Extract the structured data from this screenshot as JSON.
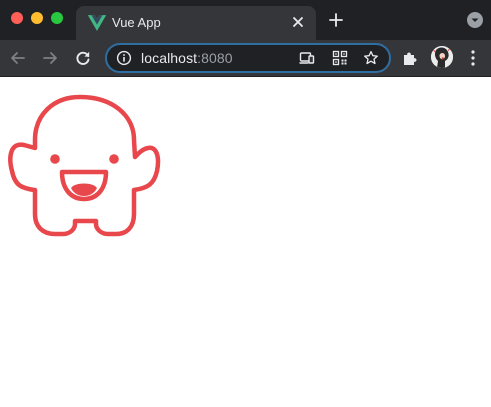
{
  "browser": {
    "tab": {
      "title": "Vue App",
      "favicon": "vue-logo-icon"
    },
    "address_bar": {
      "host": "localhost",
      "port": ":8080"
    },
    "colors": {
      "tabstrip": "#202124",
      "toolbar": "#35363a",
      "omnibox_focus_ring": "#2f6ea1",
      "vue_green": "#41b883",
      "vue_dark": "#34495e"
    }
  },
  "page": {
    "mascot": {
      "icon": "happy-monster-icon",
      "color": "#e8474c"
    }
  }
}
